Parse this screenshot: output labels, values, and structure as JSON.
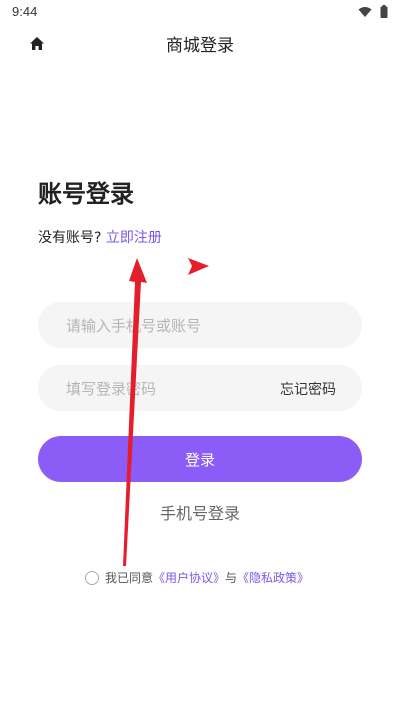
{
  "status_bar": {
    "time": "9:44"
  },
  "header": {
    "title": "商城登录"
  },
  "login": {
    "heading": "账号登录",
    "no_account_text": "没有账号?",
    "register_link": "立即注册",
    "account_placeholder": "请输入手机号或账号",
    "password_placeholder": "填写登录密码",
    "forgot_password": "忘记密码",
    "login_button": "登录",
    "phone_login": "手机号登录"
  },
  "agreement": {
    "prefix": "我已同意",
    "user_agreement": "《用户协议》",
    "and": "与",
    "privacy_policy": "《隐私政策》",
    "checked": false
  },
  "colors": {
    "accent": "#8b5cf6",
    "link": "#7b57e8",
    "annotation_arrow": "#e41e2b"
  },
  "icons": [
    "home-icon",
    "wifi-icon",
    "battery-icon"
  ]
}
